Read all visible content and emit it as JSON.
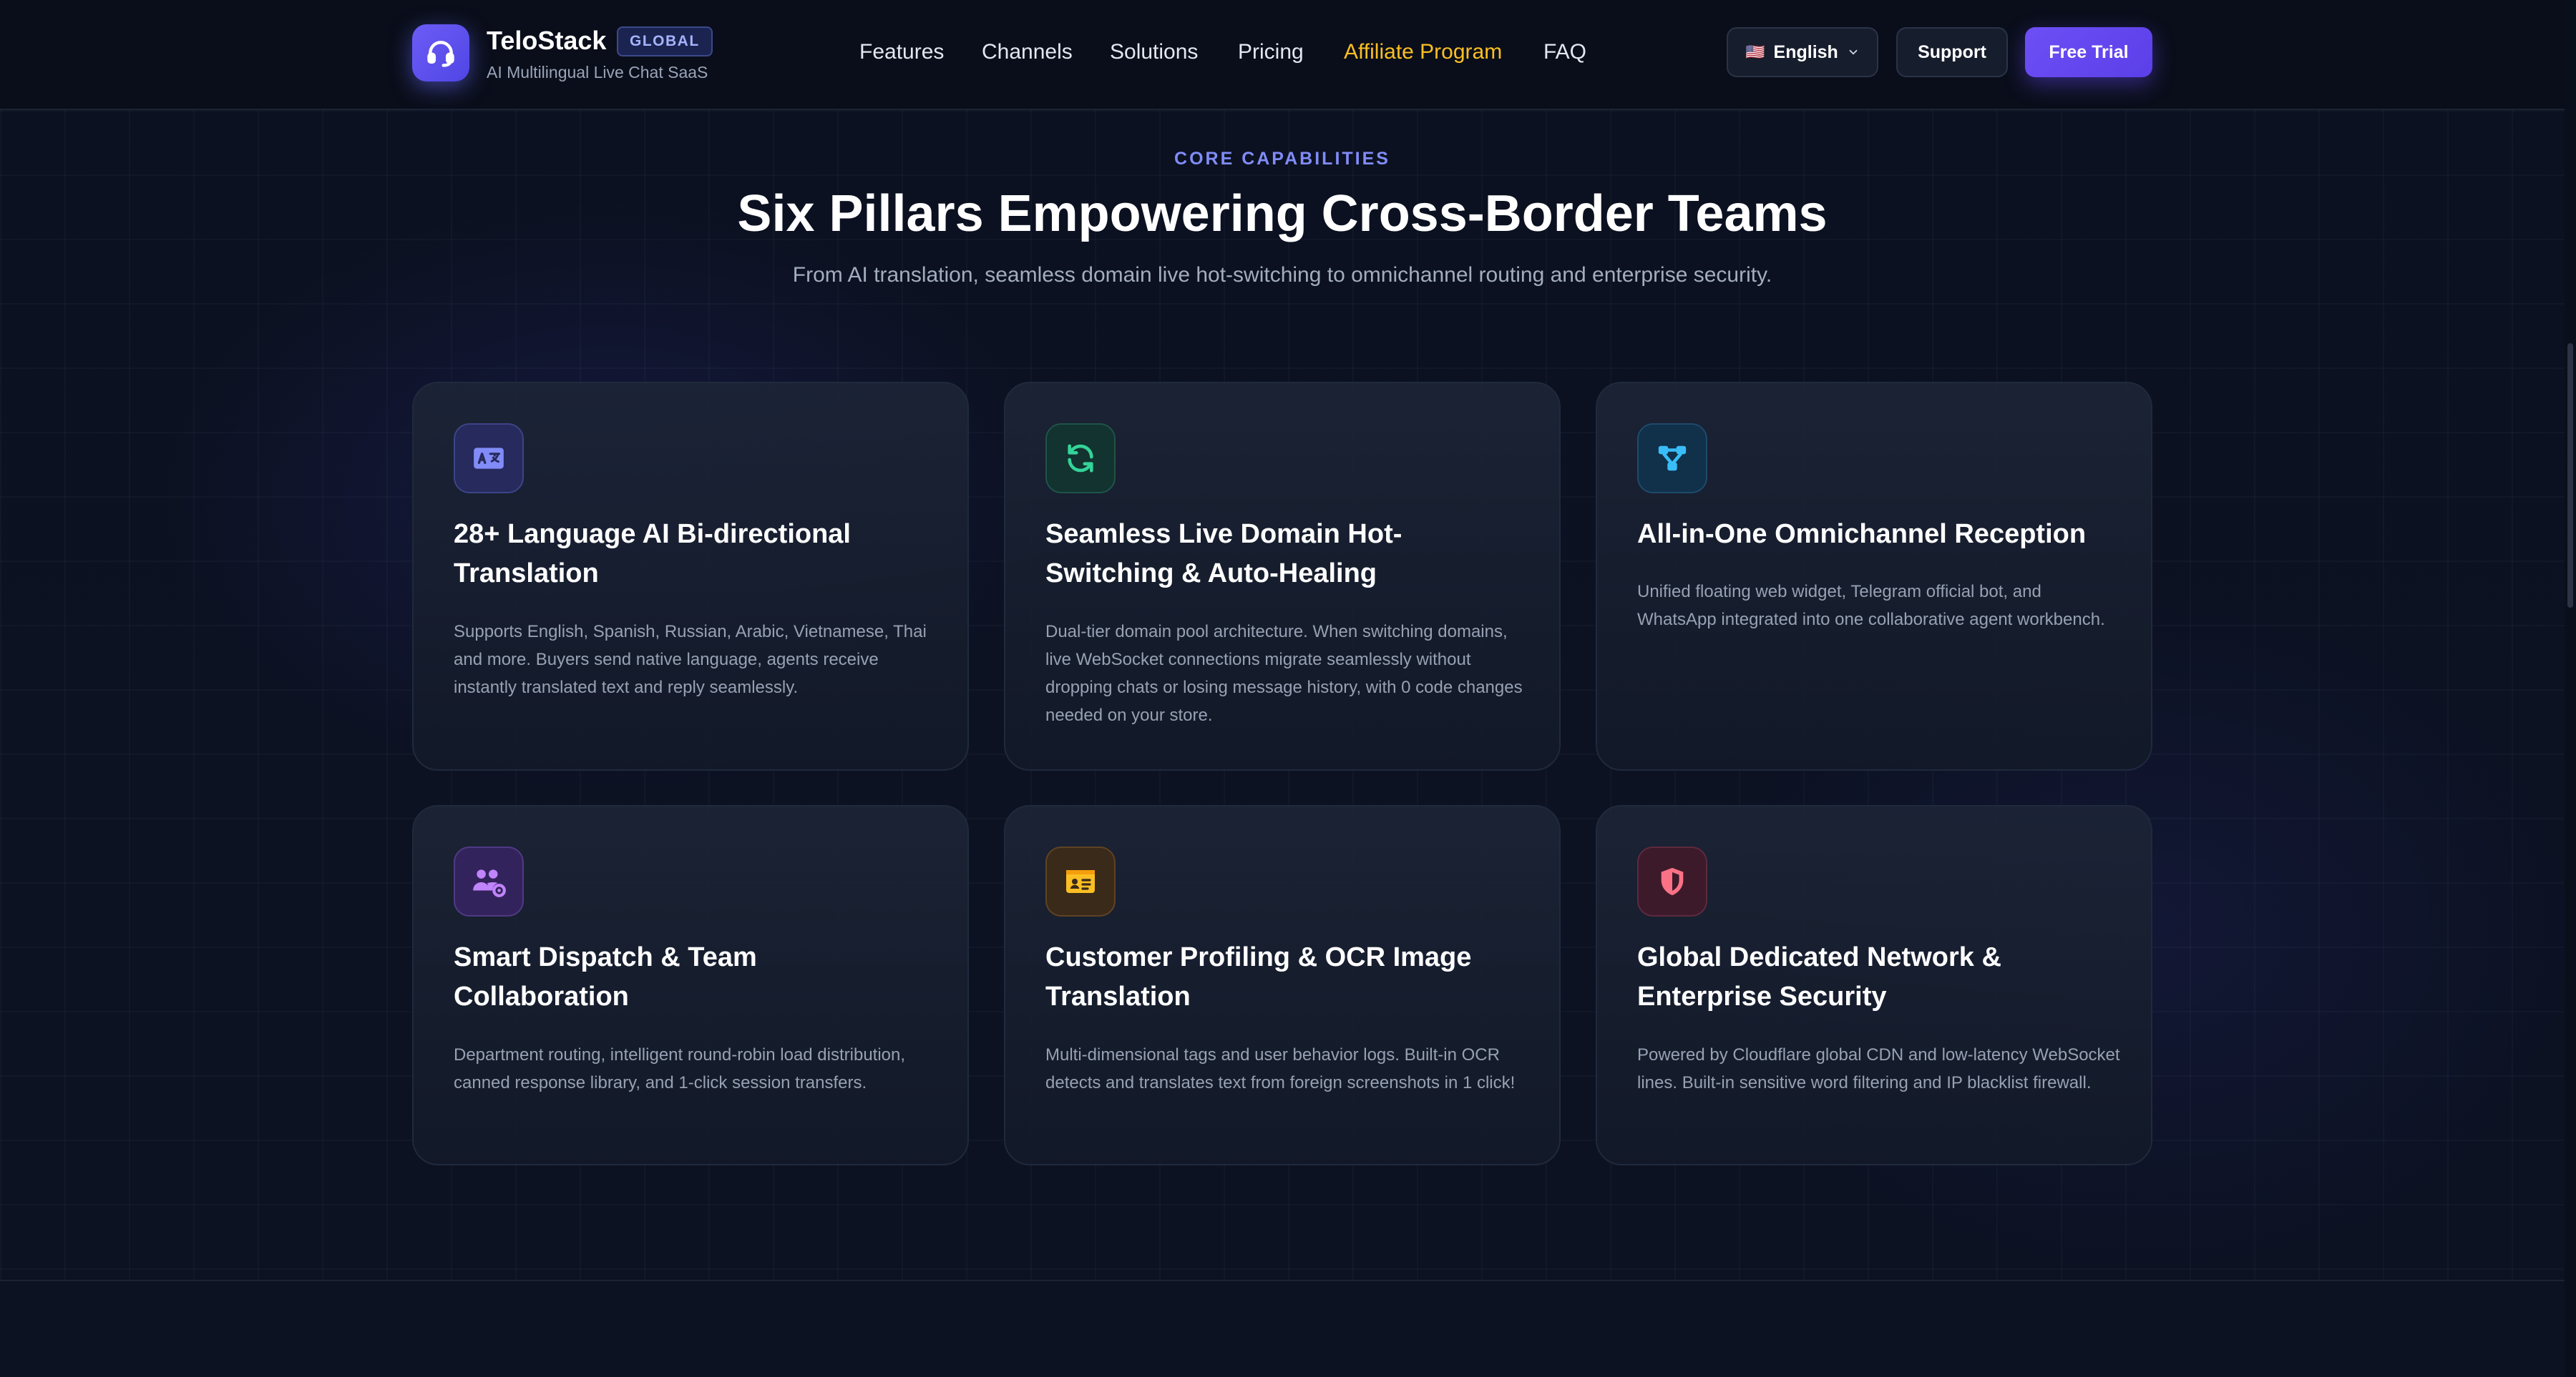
{
  "header": {
    "brand_name": "TeloStack",
    "brand_badge": "GLOBAL",
    "brand_subtitle": "AI Multilingual Live Chat SaaS",
    "logo_icon": "headset-icon",
    "nav": [
      {
        "label": "Features"
      },
      {
        "label": "Channels"
      },
      {
        "label": "Solutions"
      },
      {
        "label": "Pricing"
      },
      {
        "label": "Affiliate Program",
        "accent": true
      },
      {
        "label": "FAQ"
      }
    ],
    "language": {
      "flag": "🇺🇸",
      "label": "English"
    },
    "support_label": "Support",
    "trial_label": "Free Trial"
  },
  "section": {
    "eyebrow": "CORE CAPABILITIES",
    "title": "Six Pillars Empowering Cross-Border Teams",
    "subtitle": "From AI translation, seamless domain live hot-switching to omnichannel routing and enterprise security."
  },
  "cards": [
    {
      "icon": "translate-icon",
      "accent": "#818cf8",
      "title": "28+ Language AI Bi-directional Translation",
      "desc": "Supports English, Spanish, Russian, Arabic, Vietnamese, Thai and more. Buyers send native language, agents receive instantly translated text and reply seamlessly."
    },
    {
      "icon": "refresh-icon",
      "accent": "#34d399",
      "title": "Seamless Live Domain Hot-Switching & Auto-Healing",
      "desc": "Dual-tier domain pool architecture. When switching domains, live WebSocket connections migrate seamlessly without dropping chats or losing message history, with 0 code changes needed on your store."
    },
    {
      "icon": "network-icon",
      "accent": "#38bdf8",
      "title": "All-in-One Omnichannel Reception",
      "desc": "Unified floating web widget, Telegram official bot, and WhatsApp integrated into one collaborative agent workbench."
    },
    {
      "icon": "team-gear-icon",
      "accent": "#c084fc",
      "title": "Smart Dispatch & Team Collaboration",
      "desc": "Department routing, intelligent round-robin load distribution, canned response library, and 1-click session transfers."
    },
    {
      "icon": "id-card-icon",
      "accent": "#fbbf24",
      "title": "Customer Profiling & OCR Image Translation",
      "desc": "Multi-dimensional tags and user behavior logs. Built-in OCR detects and translates text from foreign screenshots in 1 click!"
    },
    {
      "icon": "shield-icon",
      "accent": "#fb7185",
      "title": "Global Dedicated Network & Enterprise Security",
      "desc": "Powered by Cloudflare global CDN and low-latency WebSocket lines. Built-in sensitive word filtering and IP blacklist firewall."
    }
  ]
}
